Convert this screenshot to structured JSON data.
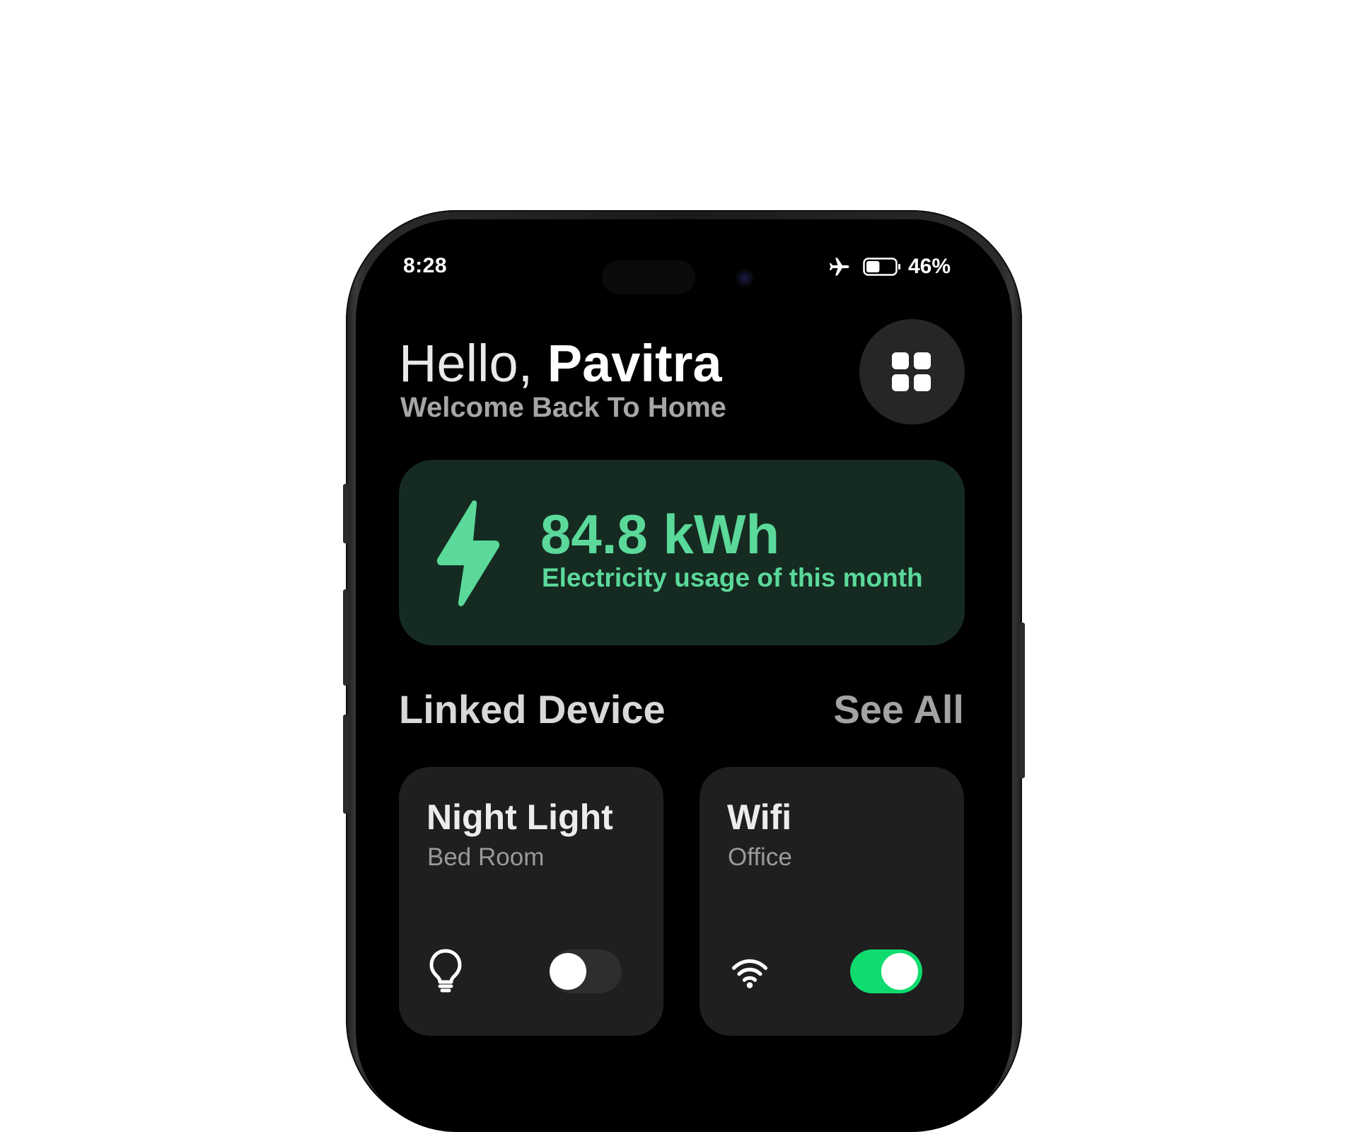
{
  "status_bar": {
    "time": "8:28",
    "battery_percent_text": "46%",
    "battery_level": 0.46,
    "airplane_icon": "airplane-icon"
  },
  "header": {
    "hello": "Hello,",
    "name": "Pavitra",
    "subtitle": "Welcome Back To Home",
    "menu_icon": "grid-menu-icon"
  },
  "energy": {
    "value": "84.8 kWh",
    "label": "Electricity usage of this month",
    "icon": "lightning-bolt-icon",
    "accent_color": "#5bd99a",
    "card_color": "#152b21"
  },
  "linked_devices": {
    "title": "Linked Device",
    "see_all": "See All",
    "devices": [
      {
        "name": "Night Light",
        "room": "Bed Room",
        "icon": "lightbulb-icon",
        "on": false
      },
      {
        "name": "Wifi",
        "room": "Office",
        "icon": "wifi-icon",
        "on": true
      }
    ]
  },
  "colors": {
    "toggle_on": "#0fdc6e",
    "toggle_off": "#2e2e2e",
    "screen_bg": "#000000",
    "card_bg": "#1f1f1f"
  }
}
